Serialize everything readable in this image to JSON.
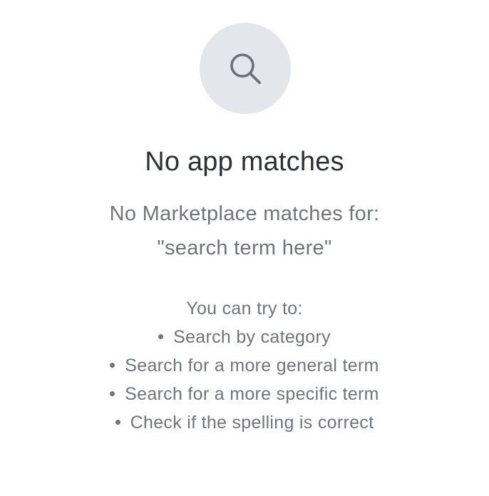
{
  "empty_state": {
    "icon": "search-icon",
    "title": "No app matches",
    "message_line1": "No Marketplace matches for:",
    "search_term": "\"search term here\"",
    "tips_heading": "You can try to:",
    "tips": [
      "Search by category",
      "Search for a more general term",
      "Search for a more specific term",
      "Check if the spelling is correct"
    ]
  },
  "colors": {
    "background": "#ffffff",
    "icon_circle": "#e3e6ea",
    "icon_stroke": "#6b7078",
    "title": "#2d3039",
    "body_text": "#6f747d"
  }
}
